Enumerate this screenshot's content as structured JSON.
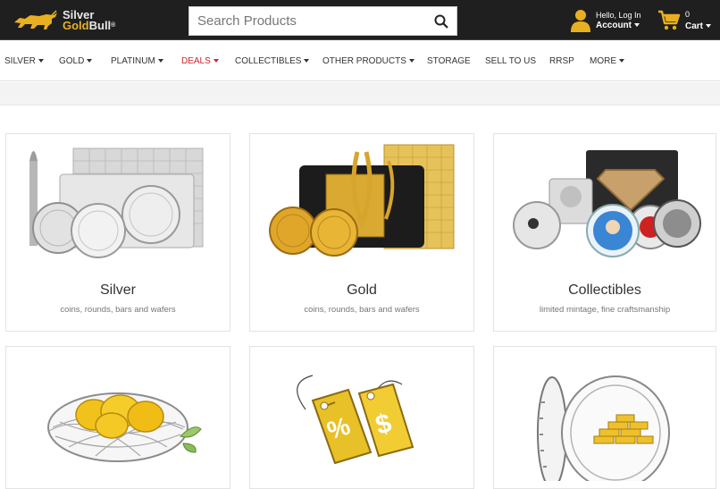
{
  "header": {
    "logo": {
      "line1": "Silver",
      "line2": "Gold",
      "line3": "Bull",
      "tm": "®"
    },
    "search": {
      "placeholder": "Search Products"
    },
    "account": {
      "greeting": "Hello, Log In",
      "label": "Account"
    },
    "cart": {
      "count": "0",
      "label": "Cart"
    }
  },
  "nav": {
    "items": [
      {
        "label": "SILVER",
        "dropdown": true
      },
      {
        "label": "GOLD",
        "dropdown": true
      },
      {
        "label": "PLATINUM",
        "dropdown": true
      },
      {
        "label": "DEALS",
        "dropdown": true
      },
      {
        "label": "COLLECTIBLES",
        "dropdown": true
      },
      {
        "label": "OTHER PRODUCTS",
        "dropdown": true
      },
      {
        "label": "STORAGE",
        "dropdown": false
      },
      {
        "label": "SELL TO US",
        "dropdown": false
      },
      {
        "label": "RRSP",
        "dropdown": false
      },
      {
        "label": "MORE",
        "dropdown": true
      }
    ]
  },
  "categories": [
    {
      "title": "Silver",
      "subtitle": "coins, rounds, bars and wafers",
      "image": "silver-products-image"
    },
    {
      "title": "Gold",
      "subtitle": "coins, rounds, bars and wafers",
      "image": "gold-products-image"
    },
    {
      "title": "Collectibles",
      "subtitle": "limited mintage, fine craftsmanship",
      "image": "collectibles-image"
    },
    {
      "title": "",
      "subtitle": "",
      "image": "gold-nest-image"
    },
    {
      "title": "",
      "subtitle": "",
      "image": "deals-tags-image"
    },
    {
      "title": "",
      "subtitle": "",
      "image": "storage-vault-image"
    }
  ],
  "colors": {
    "header_bg": "#1f1f1f",
    "brand_gold": "#e8b021",
    "deals_red": "#c9252c"
  }
}
